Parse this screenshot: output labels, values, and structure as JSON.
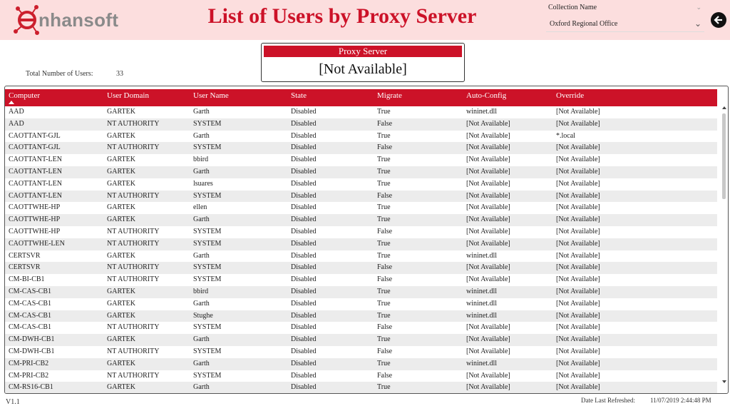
{
  "header": {
    "logo_text": "nhansoft",
    "title": "List of Users by Proxy Server",
    "brand_color": "#cc1228",
    "background_color": "#fcdede"
  },
  "slicer": {
    "label": "Collection Name",
    "value": "Oxford Regional Office",
    "chevron_icon": "chevron-down-icon"
  },
  "back_button": {
    "icon": "arrow-left-icon"
  },
  "card": {
    "label": "Proxy Server",
    "value": "[Not Available]"
  },
  "summary": {
    "total_label": "Total Number of Users:",
    "total_value": "33"
  },
  "table": {
    "columns": [
      "Computer",
      "User Domain",
      "User Name",
      "State",
      "Migrate",
      "Auto-Config",
      "Override"
    ],
    "sorted_column": "Computer",
    "rows": [
      [
        "AAD",
        "GARTEK",
        "Garth",
        "Disabled",
        "True",
        "wininet.dll",
        "[Not Available]"
      ],
      [
        "AAD",
        "NT AUTHORITY",
        "SYSTEM",
        "Disabled",
        "False",
        "[Not Available]",
        "[Not Available]"
      ],
      [
        "CAOTTANT-GJL",
        "GARTEK",
        "Garth",
        "Disabled",
        "True",
        "[Not Available]",
        "*.local"
      ],
      [
        "CAOTTANT-GJL",
        "NT AUTHORITY",
        "SYSTEM",
        "Disabled",
        "False",
        "[Not Available]",
        "[Not Available]"
      ],
      [
        "CAOTTANT-LEN",
        "GARTEK",
        "bbird",
        "Disabled",
        "True",
        "[Not Available]",
        "[Not Available]"
      ],
      [
        "CAOTTANT-LEN",
        "GARTEK",
        "Garth",
        "Disabled",
        "True",
        "[Not Available]",
        "[Not Available]"
      ],
      [
        "CAOTTANT-LEN",
        "GARTEK",
        "lsuares",
        "Disabled",
        "True",
        "[Not Available]",
        "[Not Available]"
      ],
      [
        "CAOTTANT-LEN",
        "NT AUTHORITY",
        "SYSTEM",
        "Disabled",
        "False",
        "[Not Available]",
        "[Not Available]"
      ],
      [
        "CAOTTWHE-HP",
        "GARTEK",
        "ellen",
        "Disabled",
        "True",
        "[Not Available]",
        "[Not Available]"
      ],
      [
        "CAOTTWHE-HP",
        "GARTEK",
        "Garth",
        "Disabled",
        "True",
        "[Not Available]",
        "[Not Available]"
      ],
      [
        "CAOTTWHE-HP",
        "NT AUTHORITY",
        "SYSTEM",
        "Disabled",
        "False",
        "[Not Available]",
        "[Not Available]"
      ],
      [
        "CAOTTWHE-LEN",
        "NT AUTHORITY",
        "SYSTEM",
        "Disabled",
        "True",
        "[Not Available]",
        "[Not Available]"
      ],
      [
        "CERTSVR",
        "GARTEK",
        "Garth",
        "Disabled",
        "True",
        "wininet.dll",
        "[Not Available]"
      ],
      [
        "CERTSVR",
        "NT AUTHORITY",
        "SYSTEM",
        "Disabled",
        "False",
        "[Not Available]",
        "[Not Available]"
      ],
      [
        "CM-BI-CB1",
        "NT AUTHORITY",
        "SYSTEM",
        "Disabled",
        "False",
        "[Not Available]",
        "[Not Available]"
      ],
      [
        "CM-CAS-CB1",
        "GARTEK",
        "bbird",
        "Disabled",
        "True",
        "wininet.dll",
        "[Not Available]"
      ],
      [
        "CM-CAS-CB1",
        "GARTEK",
        "Garth",
        "Disabled",
        "True",
        "wininet.dll",
        "[Not Available]"
      ],
      [
        "CM-CAS-CB1",
        "GARTEK",
        "Stughe",
        "Disabled",
        "True",
        "wininet.dll",
        "[Not Available]"
      ],
      [
        "CM-CAS-CB1",
        "NT AUTHORITY",
        "SYSTEM",
        "Disabled",
        "False",
        "[Not Available]",
        "[Not Available]"
      ],
      [
        "CM-DWH-CB1",
        "GARTEK",
        "Garth",
        "Disabled",
        "True",
        "[Not Available]",
        "[Not Available]"
      ],
      [
        "CM-DWH-CB1",
        "NT AUTHORITY",
        "SYSTEM",
        "Disabled",
        "False",
        "[Not Available]",
        "[Not Available]"
      ],
      [
        "CM-PRI-CB2",
        "GARTEK",
        "Garth",
        "Disabled",
        "True",
        "wininet.dll",
        "[Not Available]"
      ],
      [
        "CM-PRI-CB2",
        "NT AUTHORITY",
        "SYSTEM",
        "Disabled",
        "False",
        "[Not Available]",
        "[Not Available]"
      ],
      [
        "CM-RS16-CB1",
        "GARTEK",
        "Garth",
        "Disabled",
        "True",
        "[Not Available]",
        "[Not Available]"
      ]
    ]
  },
  "footer": {
    "version": "V1.1",
    "refresh_label": "Date Last Refreshed:",
    "refresh_value": "11/07/2019 2:44:48 PM"
  }
}
